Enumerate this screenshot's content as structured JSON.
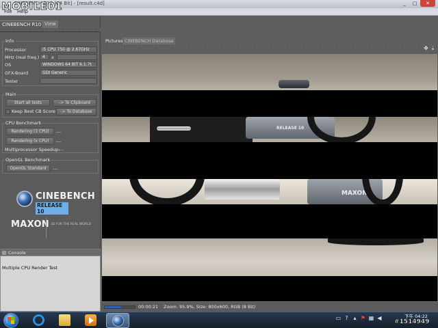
{
  "window": {
    "title": "CINEBENCH R10 [64 Bit] - [result.c4d]",
    "watermark": "MOBILE01",
    "minimize": "_",
    "maximize": "□",
    "close": "✕"
  },
  "menu": {
    "file": "File",
    "help": "Help"
  },
  "left_tabs": {
    "active": "CINEBENCH R10",
    "inactive": "View"
  },
  "info": {
    "title": "Info",
    "processor_label": "Processor",
    "processor_value": "i5 CPU 750 @ 2.67GHz",
    "mhz_label": "MHz (real freq.)",
    "mhz_value": "4",
    "mhz_x": "x",
    "os_label": "OS",
    "os_value": "WINDOWS 64 BIT 6.1.7t",
    "gfx_label": "GFX-Board",
    "gfx_value": "GDI Generic",
    "tester_label": "Tester",
    "tester_value": ""
  },
  "main": {
    "title": "Main",
    "start_all": "Start all tests",
    "to_clipboard": "-> To Clipboard",
    "keep_best": "Keep Best CB Score",
    "to_database": "-> To Database"
  },
  "cpu": {
    "title": "CPU Benchmark",
    "single_button": "Rendering (1 CPU)",
    "single_result": "---",
    "multi_button": "Rendering (x CPU)",
    "multi_result": "---",
    "speedup_label": "Multiprocessor Speedup:",
    "speedup_result": "---"
  },
  "opengl": {
    "title": "OpenGL Benchmark",
    "button": "OpenGL Standard",
    "result": "---"
  },
  "logo": {
    "cinebench": "CINEBENCH",
    "release": "RELEASE 10",
    "maxon": "MAXON",
    "tagline": "3D FOR THE REAL WORLD"
  },
  "console": {
    "title": "Console",
    "text": "Multiple CPU Render Test"
  },
  "right_tabs": {
    "active": "Pictures",
    "inactive": "CINEBENCH Database"
  },
  "render_labels": {
    "release": "RELEASE 10",
    "maxon": "MAXON"
  },
  "status": {
    "progress": 0.55,
    "time": "00:00:21",
    "zoom": "Zoom: 95.9%, Size: 800x600, RGB (8 Bit)"
  },
  "taskbar": {
    "clock_line1": "下午 04:22",
    "clock_line2": "",
    "reference": "#1514949"
  },
  "icons": {
    "move": "move-icon",
    "download": "arrow-down-icon",
    "tray": [
      "keyboard-icon",
      "help-icon",
      "flag-icon",
      "network-icon",
      "volume-icon"
    ]
  }
}
